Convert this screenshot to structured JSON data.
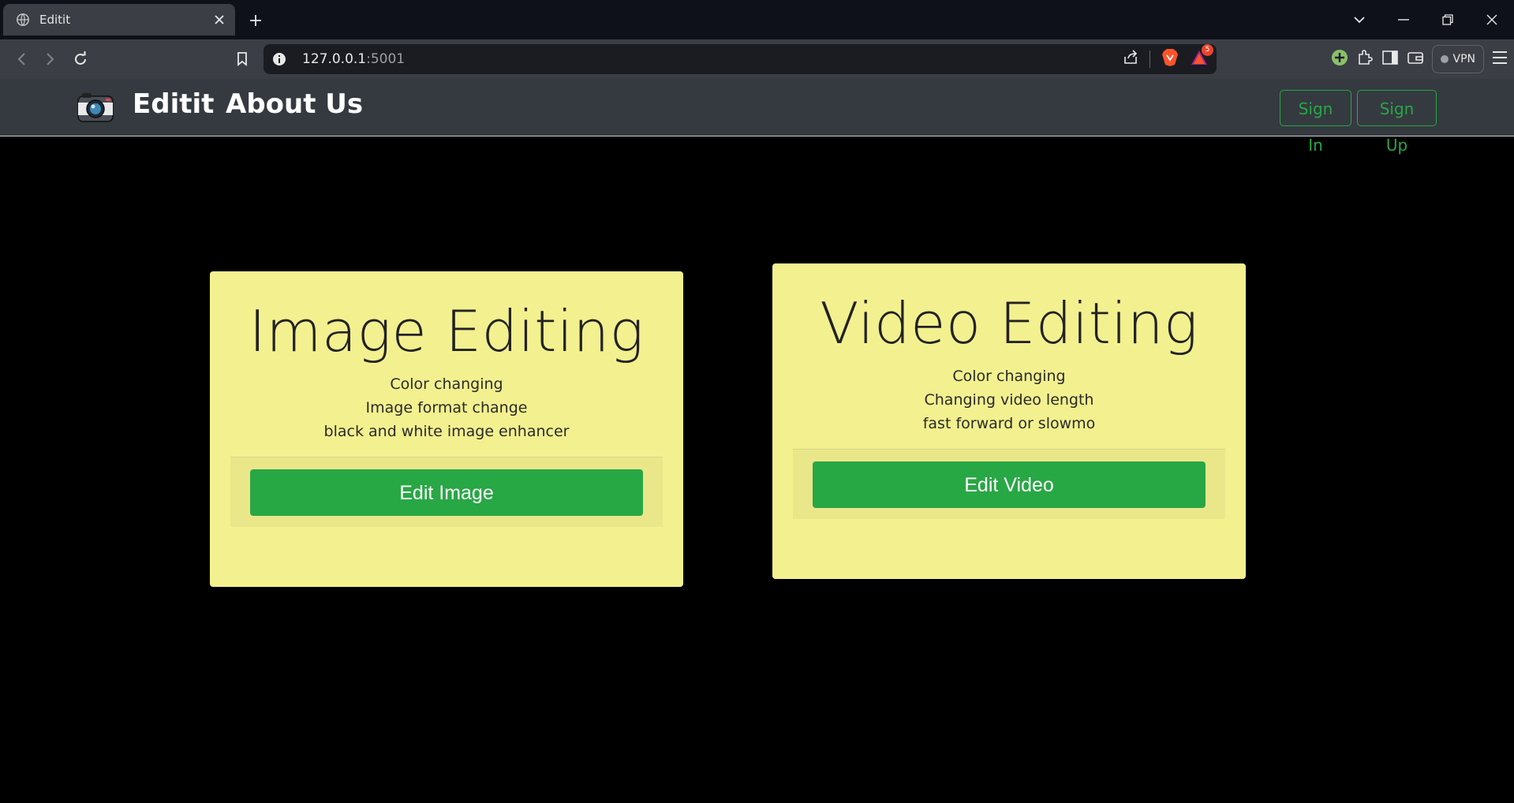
{
  "browser": {
    "tab_title": "Editit",
    "url_host": "127.0.0.1",
    "url_port": ":5001",
    "vpn_label": "VPN",
    "alerts_badge": "5"
  },
  "navbar": {
    "brand": "Editit",
    "about_link": "About Us",
    "sign_in": "Sign In",
    "sign_up": "Sign Up"
  },
  "cards": [
    {
      "title": "Image Editing",
      "features": [
        "Color changing",
        "Image format change",
        "black and white image enhancer"
      ],
      "button": "Edit Image"
    },
    {
      "title": "Video Editing",
      "features": [
        "Color changing",
        "Changing video length",
        "fast forward or slowmo"
      ],
      "button": "Edit Video"
    }
  ],
  "colors": {
    "page_background": "#000000",
    "navbar_background": "#343a40",
    "card_background": "#f3f08f",
    "accent_green": "#28a745"
  },
  "icons": {
    "logo": "camera-icon",
    "tab_favicon": "globe-icon"
  }
}
